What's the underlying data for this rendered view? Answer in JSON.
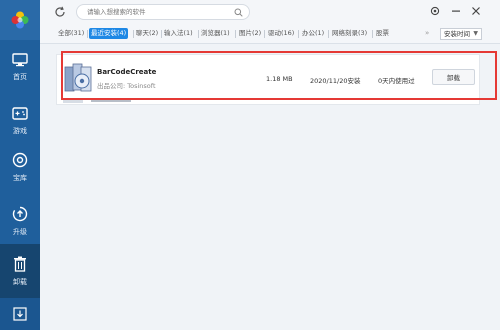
{
  "sidebar": {
    "items": [
      {
        "label": "首页",
        "icon": "monitor-icon"
      },
      {
        "label": "游戏",
        "icon": "gamepad-icon"
      },
      {
        "label": "宝库",
        "icon": "disc-icon"
      },
      {
        "label": "升级",
        "icon": "upgrade-icon"
      },
      {
        "label": "卸载",
        "icon": "trash-icon"
      }
    ],
    "active": "卸载"
  },
  "search": {
    "placeholder": "请输入想搜索的软件"
  },
  "tabs": [
    {
      "label": "全部(31)"
    },
    {
      "label": "最近安装(4)"
    },
    {
      "label": "聊天(2)"
    },
    {
      "label": "输入法(1)"
    },
    {
      "label": "浏览器(1)"
    },
    {
      "label": "图片(2)"
    },
    {
      "label": "驱动(16)"
    },
    {
      "label": "办公(1)"
    },
    {
      "label": "网络刻录(3)"
    },
    {
      "label": "股票"
    }
  ],
  "more_tabs": "»",
  "sort": {
    "label": "安装时间"
  },
  "apps": [
    {
      "name": "BarCodeCreate",
      "publisher": "出品公司: Tosinsoft",
      "size": "1.18 MB",
      "install_date": "2020/11/20安装",
      "last_used": "0天内使用过",
      "action": "卸载"
    }
  ],
  "colors": {
    "sidebar": "#1f5f9c",
    "active_tab": "#1e88e5",
    "highlight": "#e53935"
  }
}
